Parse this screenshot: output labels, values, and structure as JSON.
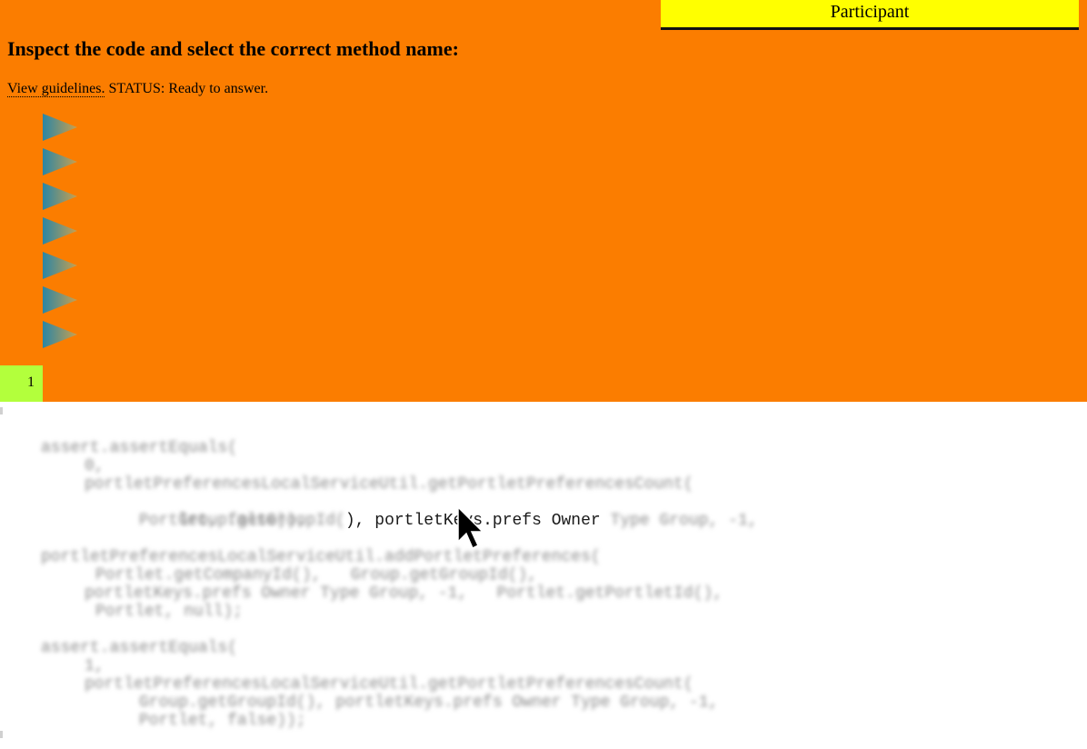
{
  "header": {
    "participant_label": "Participant",
    "title": "Inspect the code and select the correct method name:",
    "guidelines_link": "View guidelines.",
    "status_text": "STATUS: Ready to answer."
  },
  "options": {
    "count": 7,
    "icon": "play-arrow-icon",
    "colors": [
      "#2a86a5",
      "#c8a050"
    ]
  },
  "pagination": {
    "current_page": "1"
  },
  "code": {
    "blurred_line_1": "assert.assertEquals(",
    "blurred_line_2": "0,",
    "blurred_line_3": "portletPreferencesLocalServiceUtil.getPortletPreferencesCount(",
    "line4_blurred_prefix": "Group.getGroupId(",
    "line4_visible": "), portletKeys.prefs Owner",
    "line4_blurred_suffix": "Type Group, -1,",
    "blurred_line_5": "Portlet, false));",
    "blurred_line_6": "portletPreferencesLocalServiceUtil.addPortletPreferences(",
    "blurred_line_7": "Portlet.getCompanyId(),   Group.getGroupId(),",
    "blurred_line_8": "portletKeys.prefs Owner Type Group, -1,   Portlet.getPortletId(),",
    "blurred_line_9": "Portlet, null);",
    "blurred_line_10": "assert.assertEquals(",
    "blurred_line_11": "1,",
    "blurred_line_12": "portletPreferencesLocalServiceUtil.getPortletPreferencesCount(",
    "blurred_line_13": "Group.getGroupId(), portletKeys.prefs Owner Type Group, -1,",
    "blurred_line_14": "Portlet, false));"
  }
}
